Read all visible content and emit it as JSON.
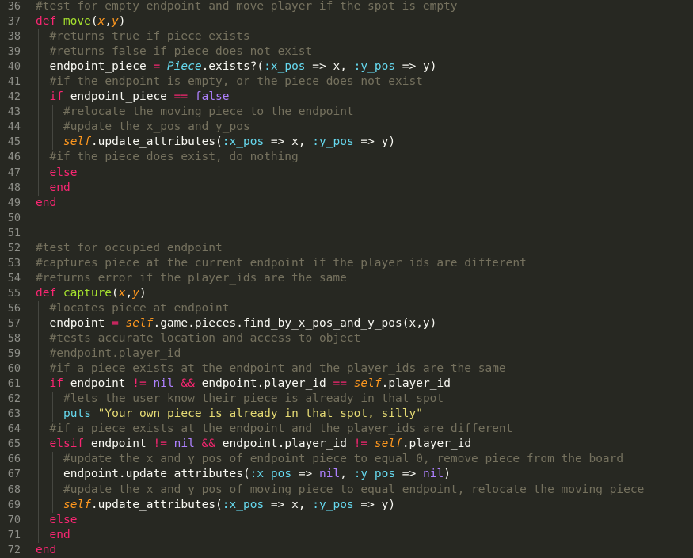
{
  "editor": {
    "lines": [
      {
        "num": "36",
        "indent": 0,
        "tokens": [
          {
            "t": "#test for empty endpoint and move player if the spot is empty",
            "c": "c"
          }
        ]
      },
      {
        "num": "37",
        "indent": 0,
        "tokens": [
          {
            "t": "def ",
            "c": "k"
          },
          {
            "t": "move",
            "c": "f"
          },
          {
            "t": "(",
            "c": "t"
          },
          {
            "t": "x",
            "c": "p"
          },
          {
            "t": ",",
            "c": "t"
          },
          {
            "t": "y",
            "c": "p"
          },
          {
            "t": ")",
            "c": "t"
          }
        ]
      },
      {
        "num": "38",
        "indent": 1,
        "tokens": [
          {
            "t": "#returns true if piece exists",
            "c": "c"
          }
        ]
      },
      {
        "num": "39",
        "indent": 1,
        "tokens": [
          {
            "t": "#returns false if piece does not exist",
            "c": "c"
          }
        ]
      },
      {
        "num": "40",
        "indent": 1,
        "tokens": [
          {
            "t": "endpoint_piece ",
            "c": "t"
          },
          {
            "t": "=",
            "c": "k"
          },
          {
            "t": " ",
            "c": "t"
          },
          {
            "t": "Piece",
            "c": "s"
          },
          {
            "t": ".exists?(",
            "c": "t"
          },
          {
            "t": ":x_pos",
            "c": "y"
          },
          {
            "t": " => x, ",
            "c": "t"
          },
          {
            "t": ":y_pos",
            "c": "y"
          },
          {
            "t": " => y)",
            "c": "t"
          }
        ]
      },
      {
        "num": "41",
        "indent": 1,
        "tokens": [
          {
            "t": "#if the endpoint is empty, or the piece does not exist",
            "c": "c"
          }
        ]
      },
      {
        "num": "42",
        "indent": 1,
        "tokens": [
          {
            "t": "if",
            "c": "k"
          },
          {
            "t": " endpoint_piece ",
            "c": "t"
          },
          {
            "t": "==",
            "c": "k"
          },
          {
            "t": " ",
            "c": "t"
          },
          {
            "t": "false",
            "c": "n"
          }
        ]
      },
      {
        "num": "43",
        "indent": 2,
        "tokens": [
          {
            "t": "#relocate the moving piece to the endpoint",
            "c": "c"
          }
        ]
      },
      {
        "num": "44",
        "indent": 2,
        "tokens": [
          {
            "t": "#update the x_pos and y_pos",
            "c": "c"
          }
        ]
      },
      {
        "num": "45",
        "indent": 2,
        "tokens": [
          {
            "t": "self",
            "c": "p"
          },
          {
            "t": ".update_attributes(",
            "c": "t"
          },
          {
            "t": ":x_pos",
            "c": "y"
          },
          {
            "t": " => x, ",
            "c": "t"
          },
          {
            "t": ":y_pos",
            "c": "y"
          },
          {
            "t": " => y)",
            "c": "t"
          }
        ]
      },
      {
        "num": "46",
        "indent": 1,
        "tokens": [
          {
            "t": "#if the piece does exist, do nothing",
            "c": "c"
          }
        ]
      },
      {
        "num": "47",
        "indent": 1,
        "tokens": [
          {
            "t": "else",
            "c": "k"
          }
        ]
      },
      {
        "num": "48",
        "indent": 1,
        "tokens": [
          {
            "t": "end",
            "c": "k"
          }
        ]
      },
      {
        "num": "49",
        "indent": 0,
        "tokens": [
          {
            "t": "end",
            "c": "k"
          }
        ]
      },
      {
        "num": "50",
        "indent": 0,
        "tokens": []
      },
      {
        "num": "51",
        "indent": 0,
        "tokens": []
      },
      {
        "num": "52",
        "indent": 0,
        "tokens": [
          {
            "t": "#test for occupied endpoint",
            "c": "c"
          }
        ]
      },
      {
        "num": "53",
        "indent": 0,
        "tokens": [
          {
            "t": "#captures piece at the current endpoint if the player_ids are different",
            "c": "c"
          }
        ]
      },
      {
        "num": "54",
        "indent": 0,
        "tokens": [
          {
            "t": "#returns error if the player_ids are the same",
            "c": "c"
          }
        ]
      },
      {
        "num": "55",
        "indent": 0,
        "tokens": [
          {
            "t": "def ",
            "c": "k"
          },
          {
            "t": "capture",
            "c": "f"
          },
          {
            "t": "(",
            "c": "t"
          },
          {
            "t": "x",
            "c": "p"
          },
          {
            "t": ",",
            "c": "t"
          },
          {
            "t": "y",
            "c": "p"
          },
          {
            "t": ")",
            "c": "t"
          }
        ]
      },
      {
        "num": "56",
        "indent": 1,
        "tokens": [
          {
            "t": "#locates piece at endpoint",
            "c": "c"
          }
        ]
      },
      {
        "num": "57",
        "indent": 1,
        "tokens": [
          {
            "t": "endpoint ",
            "c": "t"
          },
          {
            "t": "=",
            "c": "k"
          },
          {
            "t": " ",
            "c": "t"
          },
          {
            "t": "self",
            "c": "p"
          },
          {
            "t": ".game.pieces.find_by_x_pos_and_y_pos(x,y)",
            "c": "t"
          }
        ]
      },
      {
        "num": "58",
        "indent": 1,
        "tokens": [
          {
            "t": "#tests accurate location and access to object",
            "c": "c"
          }
        ]
      },
      {
        "num": "59",
        "indent": 1,
        "tokens": [
          {
            "t": "#endpoint.player_id",
            "c": "c"
          }
        ]
      },
      {
        "num": "60",
        "indent": 1,
        "tokens": [
          {
            "t": "#if a piece exists at the endpoint and the player_ids are the same",
            "c": "c"
          }
        ]
      },
      {
        "num": "61",
        "indent": 1,
        "tokens": [
          {
            "t": "if",
            "c": "k"
          },
          {
            "t": " endpoint ",
            "c": "t"
          },
          {
            "t": "!=",
            "c": "k"
          },
          {
            "t": " ",
            "c": "t"
          },
          {
            "t": "nil",
            "c": "n"
          },
          {
            "t": " ",
            "c": "t"
          },
          {
            "t": "&&",
            "c": "k"
          },
          {
            "t": " endpoint.player_id ",
            "c": "t"
          },
          {
            "t": "==",
            "c": "k"
          },
          {
            "t": " ",
            "c": "t"
          },
          {
            "t": "self",
            "c": "p"
          },
          {
            "t": ".player_id",
            "c": "t"
          }
        ]
      },
      {
        "num": "62",
        "indent": 2,
        "tokens": [
          {
            "t": "#lets the user know their piece is already in that spot",
            "c": "c"
          }
        ]
      },
      {
        "num": "63",
        "indent": 2,
        "tokens": [
          {
            "t": "puts",
            "c": "y"
          },
          {
            "t": " ",
            "c": "t"
          },
          {
            "t": "\"Your own piece is already in that spot, silly\"",
            "c": "str"
          }
        ]
      },
      {
        "num": "64",
        "indent": 1,
        "tokens": [
          {
            "t": "#if a piece exists at the endpoint and the player_ids are different",
            "c": "c"
          }
        ]
      },
      {
        "num": "65",
        "indent": 1,
        "tokens": [
          {
            "t": "elsif",
            "c": "k"
          },
          {
            "t": " endpoint ",
            "c": "t"
          },
          {
            "t": "!=",
            "c": "k"
          },
          {
            "t": " ",
            "c": "t"
          },
          {
            "t": "nil",
            "c": "n"
          },
          {
            "t": " ",
            "c": "t"
          },
          {
            "t": "&&",
            "c": "k"
          },
          {
            "t": " endpoint.player_id ",
            "c": "t"
          },
          {
            "t": "!=",
            "c": "k"
          },
          {
            "t": " ",
            "c": "t"
          },
          {
            "t": "self",
            "c": "p"
          },
          {
            "t": ".player_id",
            "c": "t"
          }
        ]
      },
      {
        "num": "66",
        "indent": 2,
        "tokens": [
          {
            "t": "#update the x and y pos of endpoint piece to equal 0, remove piece from the board",
            "c": "c"
          }
        ]
      },
      {
        "num": "67",
        "indent": 2,
        "tokens": [
          {
            "t": "endpoint.update_attributes(",
            "c": "t"
          },
          {
            "t": ":x_pos",
            "c": "y"
          },
          {
            "t": " => ",
            "c": "t"
          },
          {
            "t": "nil",
            "c": "n"
          },
          {
            "t": ", ",
            "c": "t"
          },
          {
            "t": ":y_pos",
            "c": "y"
          },
          {
            "t": " => ",
            "c": "t"
          },
          {
            "t": "nil",
            "c": "n"
          },
          {
            "t": ")",
            "c": "t"
          }
        ]
      },
      {
        "num": "68",
        "indent": 2,
        "tokens": [
          {
            "t": "#update the x and y pos of moving piece to equal endpoint, relocate the moving piece",
            "c": "c"
          }
        ]
      },
      {
        "num": "69",
        "indent": 2,
        "tokens": [
          {
            "t": "self",
            "c": "p"
          },
          {
            "t": ".update_attributes(",
            "c": "t"
          },
          {
            "t": ":x_pos",
            "c": "y"
          },
          {
            "t": " => x, ",
            "c": "t"
          },
          {
            "t": ":y_pos",
            "c": "y"
          },
          {
            "t": " => y)",
            "c": "t"
          }
        ]
      },
      {
        "num": "70",
        "indent": 1,
        "tokens": [
          {
            "t": "else",
            "c": "k"
          }
        ]
      },
      {
        "num": "71",
        "indent": 1,
        "tokens": [
          {
            "t": "end",
            "c": "k"
          }
        ]
      },
      {
        "num": "72",
        "indent": 0,
        "tokens": [
          {
            "t": "end",
            "c": "k"
          }
        ]
      }
    ]
  }
}
